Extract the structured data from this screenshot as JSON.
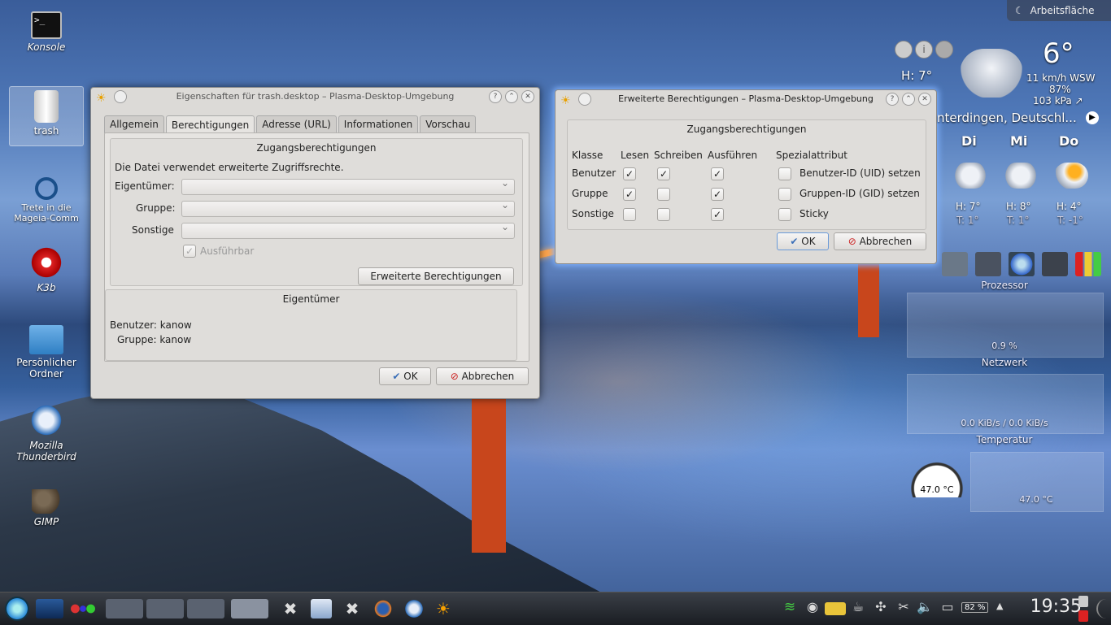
{
  "desktop": {
    "arbeitsflaeche": "Arbeitsfläche",
    "icons": [
      {
        "label": "Konsole"
      },
      {
        "label": "trash"
      },
      {
        "label": "Trete in die Mageia-Comm"
      },
      {
        "label": "K3b"
      },
      {
        "label": "Persönlicher Ordner"
      },
      {
        "label": "Mozilla Thunderbird"
      },
      {
        "label": "GIMP"
      }
    ]
  },
  "props_window": {
    "title": "Eigenschaften für trash.desktop – Plasma-Desktop-Umgebung",
    "tabs": [
      "Allgemein",
      "Berechtigungen",
      "Adresse (URL)",
      "Informationen",
      "Vorschau"
    ],
    "access_title": "Zugangsberechtigungen",
    "extended_note": "Die Datei verwendet erweiterte Zugriffsrechte.",
    "owner_label": "Eigentümer:",
    "group_label": "Gruppe:",
    "others_label": "Sonstige",
    "executable_label": "Ausführbar",
    "extended_button": "Erweiterte Berechtigungen",
    "owner_title": "Eigentümer",
    "user_line": "Benutzer: kanow",
    "group_line": "Gruppe: kanow",
    "ok": "OK",
    "cancel": "Abbrechen"
  },
  "ext_window": {
    "title": "Erweiterte Berechtigungen – Plasma-Desktop-Umgebung",
    "group_title": "Zugangsberechtigungen",
    "headers": [
      "Klasse",
      "Lesen",
      "Schreiben",
      "Ausführen",
      "Spezialattribut"
    ],
    "rows": [
      {
        "klasse": "Benutzer",
        "lesen": true,
        "schreiben": true,
        "ausfuehren": true,
        "special": "Benutzer-ID (UID) setzen"
      },
      {
        "klasse": "Gruppe",
        "lesen": true,
        "schreiben": false,
        "ausfuehren": true,
        "special": "Gruppen-ID (GID) setzen"
      },
      {
        "klasse": "Sonstige",
        "lesen": false,
        "schreiben": false,
        "ausfuehren": true,
        "special": "Sticky"
      }
    ],
    "ok": "OK",
    "cancel": "Abbrechen"
  },
  "weather": {
    "temp": "6°",
    "high": "H: 7°",
    "wind": "11 km/h WSW",
    "humidity": "87%",
    "pressure": "103 kPa ↗",
    "location": "nterdingen, Deutschl...",
    "days": [
      {
        "name": "Di",
        "high": "H: 7°",
        "low": "T: 1°"
      },
      {
        "name": "Mi",
        "high": "H: 8°",
        "low": "T: 1°"
      },
      {
        "name": "Do",
        "high": "H: 4°",
        "low": "T: -1°"
      }
    ]
  },
  "monitor": {
    "processor_label": "Prozessor",
    "cpu_value": "0.9 %",
    "network_label": "Netzwerk",
    "network_value": "0.0 KiB/s / 0.0 KiB/s",
    "temp_label": "Temperatur",
    "gauge_value": "47.0 °C",
    "temp_value": "47.0 °C"
  },
  "taskbar": {
    "battery": "82 %",
    "clock": "19:35"
  }
}
